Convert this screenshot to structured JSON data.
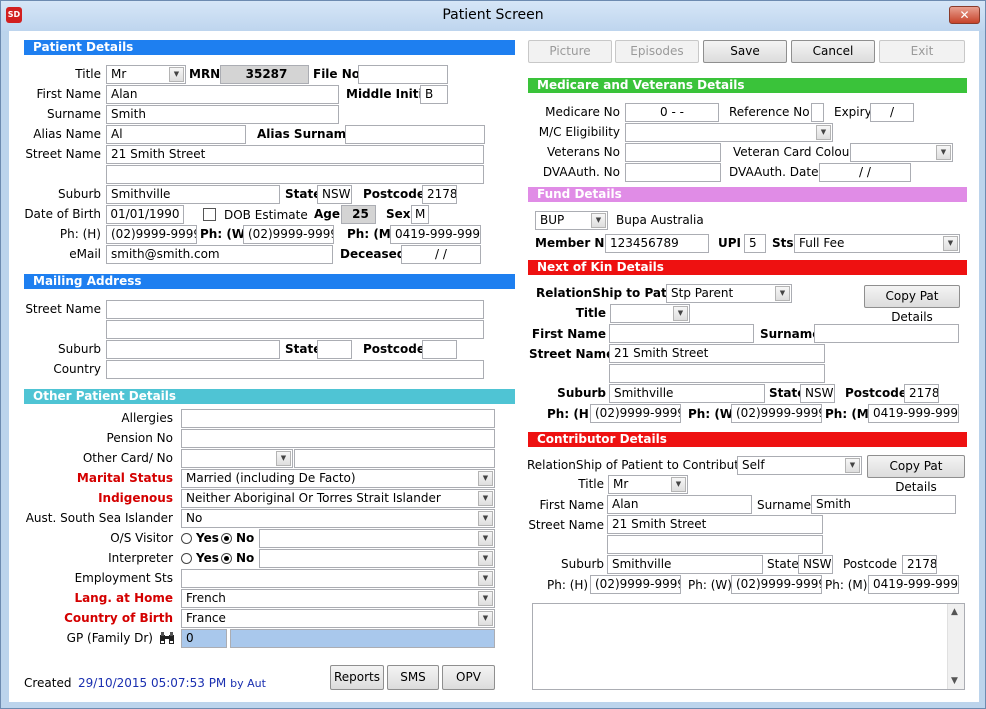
{
  "window": {
    "title": "Patient Screen",
    "icon_text": "SD",
    "close": "✕"
  },
  "toolbar": {
    "picture": "Picture",
    "episodes": "Episodes",
    "save": "Save",
    "cancel": "Cancel",
    "exit": "Exit"
  },
  "colors": {
    "patient_header": "#1e7ff0",
    "medicare_header": "#3ac33a",
    "fund_header": "#e08ce6",
    "kin_header": "#ee1111",
    "other_header": "#4fc4d4"
  },
  "patient": {
    "header": "Patient Details",
    "title_label": "Title",
    "title": "Mr",
    "mrn_label": "MRN",
    "mrn": "35287",
    "file_no_label": "File No.",
    "file_no": "",
    "first_name_label": "First Name",
    "first_name": "Alan",
    "middle_initial_label": "Middle Initial",
    "middle_initial": "B",
    "surname_label": "Surname",
    "surname": "Smith",
    "alias_name_label": "Alias Name",
    "alias_name": "Al",
    "alias_surname_label": "Alias Surname",
    "alias_surname": "",
    "street_label": "Street Name",
    "street1": "21 Smith Street",
    "street2": "",
    "suburb_label": "Suburb",
    "suburb": "Smithville",
    "state_label": "State",
    "state": "NSW",
    "postcode_label": "Postcode",
    "postcode": "2178",
    "dob_label": "Date of Birth",
    "dob": "01/01/1990",
    "dob_estimate_label": "DOB Estimate",
    "age_label": "Age",
    "age": "25",
    "sex_label": "Sex",
    "sex": "M",
    "ph_h_label": "Ph: (H)",
    "ph_h": "(02)9999-9999",
    "ph_w_label": "Ph: (W)",
    "ph_w": "(02)9999-9999",
    "ph_m_label": "Ph: (M)",
    "ph_m": "0419-999-999",
    "email_label": "eMail",
    "email": "smith@smith.com",
    "deceased_label": "Deceased",
    "deceased": "/ /"
  },
  "mailing": {
    "header": "Mailing Address",
    "street_label": "Street Name",
    "suburb_label": "Suburb",
    "state_label": "State",
    "postcode_label": "Postcode",
    "country_label": "Country"
  },
  "other": {
    "header": "Other Patient Details",
    "allergies_label": "Allergies",
    "pension_label": "Pension No",
    "other_card_label": "Other Card/ No",
    "marital_label": "Marital Status",
    "marital": "Married (including De Facto)",
    "indigenous_label": "Indigenous",
    "indigenous": "Neither Aboriginal Or Torres Strait Islander",
    "ssi_label": "Aust. South Sea Islander",
    "ssi": "No",
    "os_visitor_label": "O/S Visitor",
    "interpreter_label": "Interpreter",
    "yes": "Yes",
    "no": "No",
    "employment_label": "Employment Sts",
    "lang_label": "Lang. at Home",
    "lang": "French",
    "country_birth_label": "Country of Birth",
    "country_birth": "France",
    "gp_label": "GP (Family Dr)",
    "gp_code": "0"
  },
  "footer": {
    "created_label": "Created",
    "created_value": "29/10/2015 05:07:53 PM",
    "by": "by Aut",
    "reports": "Reports",
    "sms": "SMS",
    "opv": "OPV"
  },
  "medicare": {
    "header": "Medicare and Veterans Details",
    "medicare_no_label": "Medicare No",
    "medicare_no": "0 - -",
    "reference_label": "Reference No",
    "expiry_label": "Expiry",
    "expiry": "/",
    "mc_elig_label": "M/C Eligibility",
    "veterans_no_label": "Veterans No",
    "veteran_colour_label": "Veteran Card Colour",
    "dva_auth_no_label": "DVAAuth. No",
    "dva_auth_date_label": "DVAAuth. Date",
    "dva_auth_date": "/ /"
  },
  "fund": {
    "header": "Fund Details",
    "code": "BUP",
    "name": "Bupa Australia",
    "member_no_label": "Member No",
    "member_no": "123456789",
    "upi_label": "UPI",
    "upi": "5",
    "sts_label": "Sts",
    "sts": "Full Fee"
  },
  "kin": {
    "header": "Next of Kin Details",
    "relationship_label": "RelationShip to Patient",
    "relationship": "Stp Parent",
    "copy": "Copy Pat Details",
    "title_label": "Title",
    "title": "",
    "first_name_label": "First Name",
    "first_name": "",
    "surname_label": "Surname",
    "surname": "",
    "street_label": "Street Name",
    "street1": "21 Smith Street",
    "street2": "",
    "suburb_label": "Suburb",
    "suburb": "Smithville",
    "state_label": "State",
    "state": "NSW",
    "postcode_label": "Postcode",
    "postcode": "2178",
    "ph_h_label": "Ph: (H)",
    "ph_h": "(02)9999-9999",
    "ph_w_label": "Ph: (W)",
    "ph_w": "(02)9999-9999",
    "ph_m_label": "Ph: (M)",
    "ph_m": "0419-999-999"
  },
  "contributor": {
    "header": "Contributor Details",
    "relationship_label": "RelationShip of Patient to Contributor",
    "relationship": "Self",
    "copy": "Copy Pat Details",
    "title_label": "Title",
    "title": "Mr",
    "first_name_label": "First Name",
    "first_name": "Alan",
    "surname_label": "Surname",
    "surname": "Smith",
    "street_label": "Street Name",
    "street1": "21 Smith Street",
    "street2": "",
    "suburb_label": "Suburb",
    "suburb": "Smithville",
    "state_label": "State",
    "state": "NSW",
    "postcode_label": "Postcode",
    "postcode": "2178",
    "ph_h_label": "Ph: (H)",
    "ph_h": "(02)9999-9999",
    "ph_w_label": "Ph: (W)",
    "ph_w": "(02)9999-9999",
    "ph_m_label": "Ph: (M)",
    "ph_m": "0419-999-999"
  }
}
